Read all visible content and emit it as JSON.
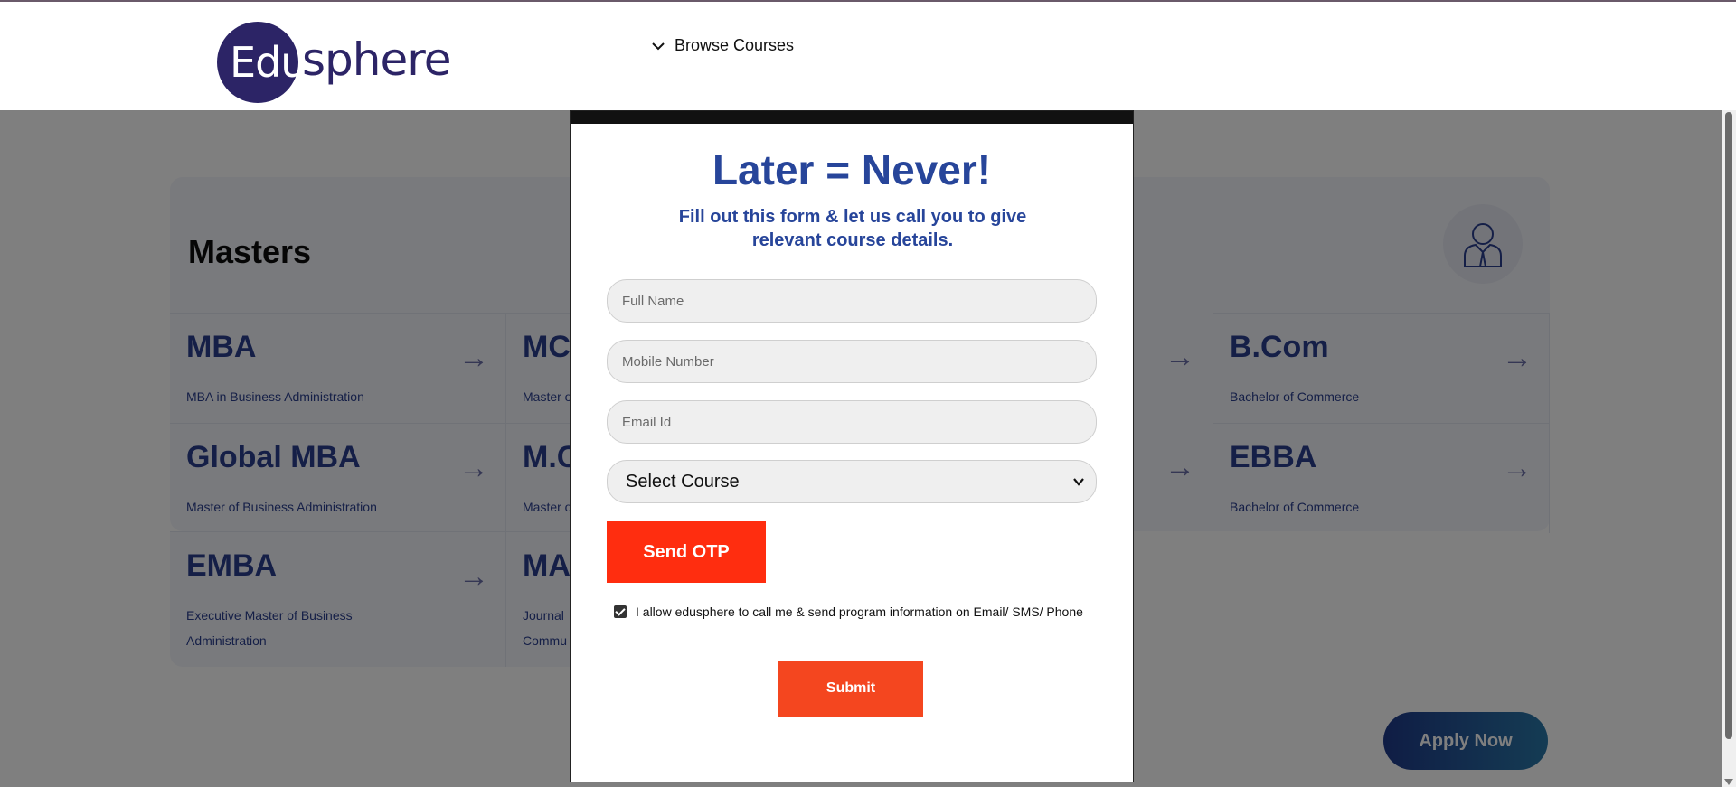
{
  "header": {
    "logo_part1": "Edu",
    "logo_part2": "sphere",
    "browse_label": "Browse Courses"
  },
  "masters": {
    "title": "Masters",
    "courses": [
      {
        "name": "MBA",
        "desc": "MBA in Business Administration"
      },
      {
        "name": "MC",
        "desc": "Master o"
      },
      {
        "name": "B.Com",
        "desc": "Bachelor of Commerce"
      },
      {
        "name": "Global MBA",
        "desc": "Master of Business Administration"
      },
      {
        "name": "M.C",
        "desc": "Master o"
      },
      {
        "name": "EBBA",
        "desc": "Bachelor of Commerce"
      },
      {
        "name": "EMBA",
        "desc": "Executive Master of Business Administration"
      },
      {
        "name": "MA",
        "desc": "Journal Commu"
      }
    ]
  },
  "apply_label": "Apply Now",
  "modal": {
    "title": "Later = Never!",
    "subtitle": "Fill out this form & let us call you to give relevant course details.",
    "full_name_placeholder": "Full Name",
    "mobile_placeholder": "Mobile Number",
    "email_placeholder": "Email Id",
    "select_value": "Select Course",
    "send_otp_label": "Send OTP",
    "consent_text": "I allow edusphere to call me & send program information on Email/ SMS/ Phone",
    "consent_checked": true,
    "submit_label": "Submit"
  }
}
